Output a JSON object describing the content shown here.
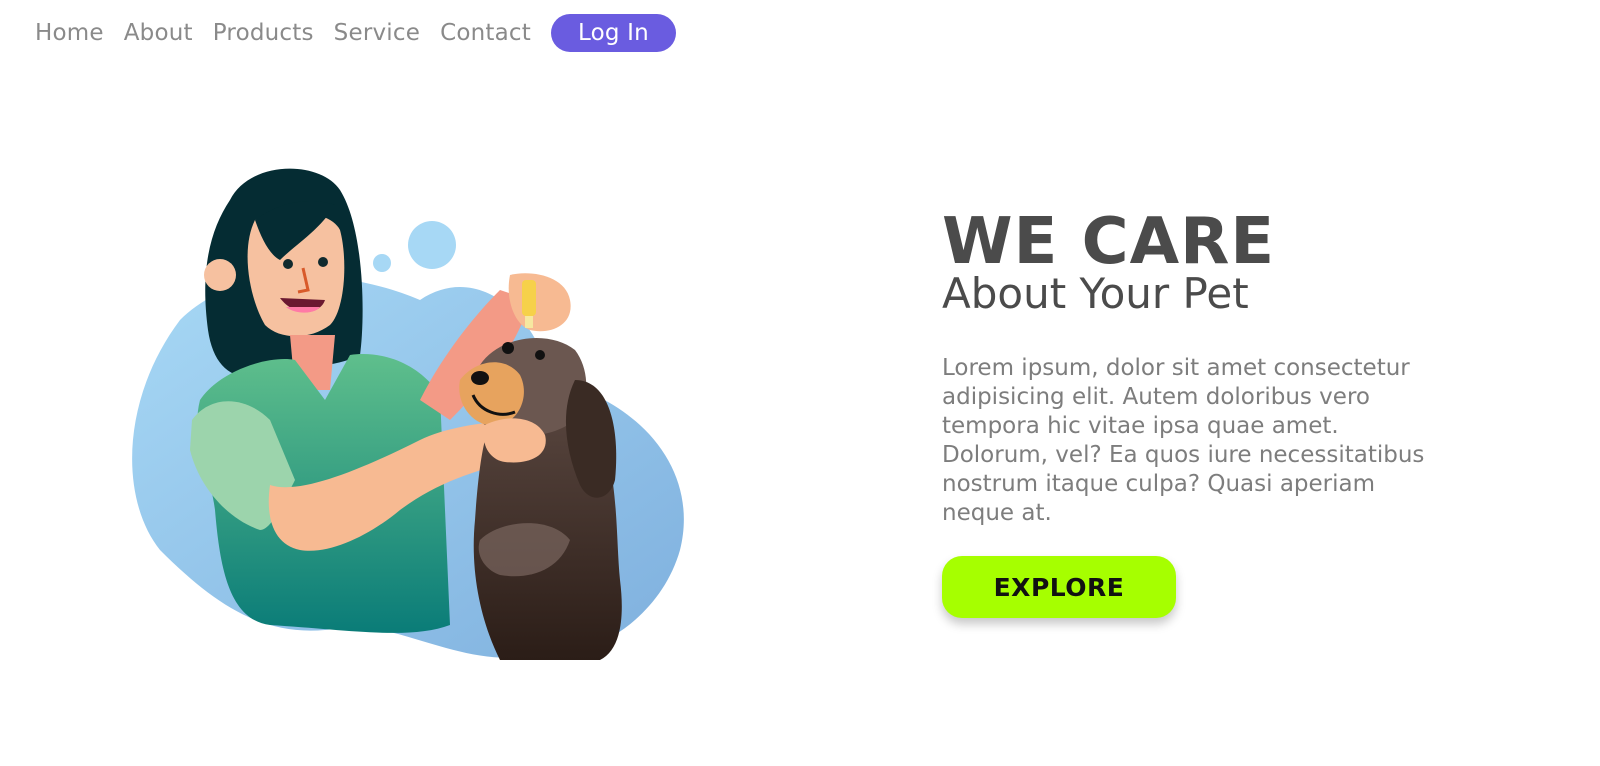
{
  "nav": {
    "items": [
      {
        "label": "Home"
      },
      {
        "label": "About"
      },
      {
        "label": "Products"
      },
      {
        "label": "Service"
      },
      {
        "label": "Contact"
      }
    ],
    "login_label": "Log In"
  },
  "hero": {
    "title": "WE CARE",
    "subtitle": "About Your Pet",
    "paragraph": "Lorem ipsum, dolor sit amet consectetur adipisicing elit. Autem doloribus vero tempora hic vitae ipsa quae amet. Dolorum, vel? Ea quos iure necessitatibus nostrum itaque culpa? Quasi aperiam neque at.",
    "cta_label": "EXPLORE"
  },
  "colors": {
    "accent": "#6a5ce0",
    "cta": "#a6ff00",
    "text_dark": "#4b4b4b",
    "text_muted": "#7d7d7d"
  },
  "illustration": {
    "name": "woman-giving-dog-ear-drops-illustration"
  }
}
